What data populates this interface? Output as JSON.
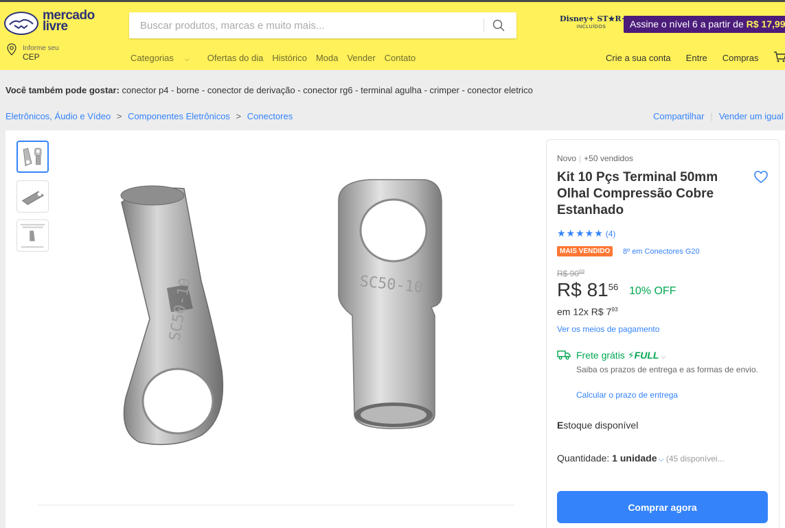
{
  "header": {
    "logo_line1": "mercado",
    "logo_line2": "livre",
    "search_placeholder": "Buscar produtos, marcas e muito mais...",
    "disney_main": "Disney+ ST★R+",
    "disney_sub": "INCLUÍDOS",
    "promo_text": "Assine o nível 6 a partir de ",
    "promo_price": "R$ 17,99",
    "cep_small": "Informe seu",
    "cep_big": "CEP",
    "nav": {
      "categorias": "Categorias",
      "ofertas": "Ofertas do dia",
      "historico": "Histórico",
      "moda": "Moda",
      "vender": "Vender",
      "contato": "Contato"
    },
    "account": {
      "crie": "Crie a sua conta",
      "entre": "Entre",
      "compras": "Compras"
    }
  },
  "also_like": {
    "label": "Você também pode gostar:",
    "items": "conector p4 - borne - conector de derivação - conector rg6 - terminal agulha - crimper - conector eletrico"
  },
  "breadcrumb": {
    "c1": "Eletrônicos, Áudio e Vídeo",
    "c2": "Componentes Eletrônicos",
    "c3": "Conectores",
    "sep": ">"
  },
  "actions": {
    "share": "Compartilhar",
    "sell": "Vender um igual"
  },
  "product": {
    "condition": "Novo",
    "sold": "+50 vendidos",
    "title": "Kit 10 Pçs Terminal 50mm Olhal Compressão Cobre Estanhado",
    "stars": "★★★★★",
    "rating_count": "(4)",
    "badge": "MAIS VENDIDO",
    "rank": "8º em Conectores G20",
    "old_price_int": "R$ 90",
    "old_price_cents": "69",
    "price_int": "R$ 81",
    "price_cents": "56",
    "discount": "10% OFF",
    "installment_int": "em 12x R$ 7",
    "installment_cents": "93",
    "payment_link": "Ver os meios de pagamento",
    "shipping": "Frete grátis",
    "full": "FULL",
    "shipping_desc": "Saiba os prazos de entrega e as formas de envio.",
    "shipping_calc": "Calcular o prazo de entrega",
    "stock_first": "E",
    "stock_rest": "stoque disponível",
    "qty_label": "Quantidade: ",
    "qty_value": "1 unidade",
    "qty_avail": "(45 disponívei...",
    "buy_button": "Comprar agora",
    "image_stamp": "SC50-10"
  },
  "colors": {
    "header_bg": "#fff159",
    "accent": "#3483fa",
    "success": "#00a650",
    "badge": "#ff7733",
    "promo_bg": "#4b1c7a"
  },
  "icons": [
    "handshake-logo",
    "search-icon",
    "location-pin-icon",
    "cart-icon",
    "heart-icon",
    "truck-icon",
    "bolt-icon",
    "chevron-down-icon"
  ]
}
